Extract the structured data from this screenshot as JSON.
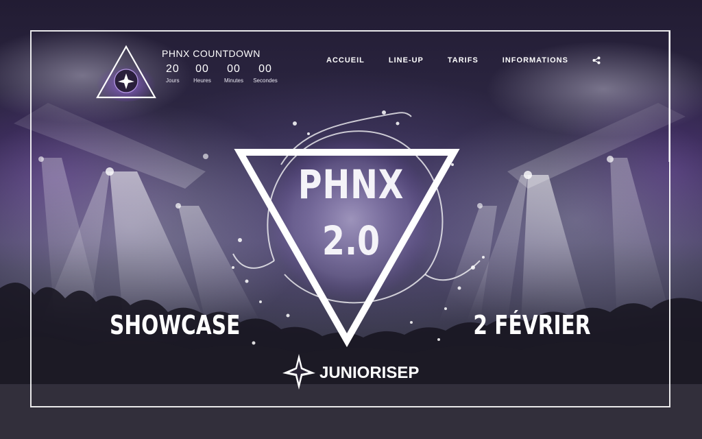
{
  "countdown": {
    "title": "PHNX COUNTDOWN",
    "units": [
      {
        "value": "20",
        "label": "Jours"
      },
      {
        "value": "00",
        "label": "Heures"
      },
      {
        "value": "00",
        "label": "Minutes"
      },
      {
        "value": "00",
        "label": "Secondes"
      }
    ]
  },
  "nav": {
    "items": [
      "ACCUEIL",
      "LINE-UP",
      "TARIFS",
      "INFORMATIONS"
    ],
    "share_icon": "share-icon"
  },
  "hero": {
    "title": "PHNX",
    "version": "2.0",
    "left_text": "SHOWCASE",
    "right_text": "2 FÉVRIER",
    "sponsor": "JUNIORISEP"
  },
  "colors": {
    "accent": "#7a4fc0",
    "text": "#ffffff",
    "frame": "#ffffff"
  }
}
